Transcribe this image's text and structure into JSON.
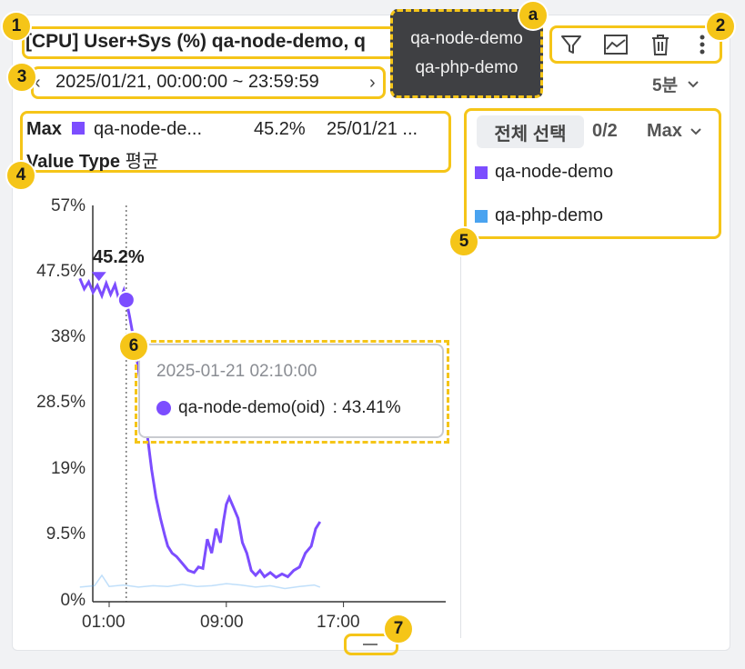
{
  "widget": {
    "title": "[CPU] User+Sys (%) qa-node-demo, q",
    "date_range": "2025/01/21, 00:00:00 ~ 23:59:59",
    "interval": "5분"
  },
  "floating_tooltip": {
    "lines": [
      "qa-node-demo",
      "qa-php-demo"
    ]
  },
  "toolbar": {
    "icons": [
      "filter-icon",
      "area-chart-icon",
      "trash-icon",
      "more-vertical-icon"
    ]
  },
  "info_panel": {
    "stat_label": "Max",
    "series": "qa-node-de...",
    "value": "45.2%",
    "time": "25/01/21 ...",
    "value_type_label": "Value Type",
    "value_type": "평균"
  },
  "legend": {
    "select_all": "전체 선택",
    "count": "0/2",
    "sort": "Max",
    "items": [
      {
        "name": "qa-node-demo",
        "color": "#7c4dff"
      },
      {
        "name": "qa-php-demo",
        "color": "#4aa3f0"
      }
    ]
  },
  "tooltip": {
    "time": "2025-01-21 02:10:00",
    "label": "qa-node-demo(oid)",
    "value": ": 43.41%"
  },
  "peak_label": "45.2%",
  "badges": {
    "b1": "1",
    "b2": "2",
    "b3": "3",
    "b4": "4",
    "b5": "5",
    "b6": "6",
    "b7": "7",
    "ba": "a"
  },
  "chart_data": {
    "type": "line",
    "y_ticks": [
      "57%",
      "47.5%",
      "38%",
      "28.5%",
      "19%",
      "9.5%",
      "0%"
    ],
    "x_ticks": [
      "01:00",
      "09:00",
      "17:00"
    ],
    "ylim": [
      0,
      57
    ],
    "xlim_hours": [
      0,
      23
    ],
    "grid": false,
    "marker": {
      "series": "qa-node-demo",
      "x": 2.17,
      "y": 43.41
    },
    "peak": {
      "x": 0.3,
      "y": 45.2
    },
    "series": [
      {
        "name": "qa-node-demo",
        "color": "#7c4dff",
        "x": [
          -1,
          -0.7,
          -0.4,
          -0.1,
          0.2,
          0.5,
          0.8,
          1.1,
          1.4,
          1.7,
          2.0,
          2.17,
          2.4,
          2.7,
          3.0,
          3.3,
          3.6,
          3.9,
          4.2,
          4.5,
          4.8,
          5.0,
          5.3,
          5.6,
          6.0,
          6.4,
          6.8,
          7.1,
          7.4,
          7.7,
          8.0,
          8.3,
          8.6,
          8.8,
          9.0,
          9.2,
          9.5,
          9.8,
          10.1,
          10.4,
          10.7,
          11.0,
          11.3,
          11.6,
          12.0,
          12.4,
          12.8,
          13.2,
          13.6,
          14.0,
          14.4,
          14.8,
          15.1,
          15.4
        ],
        "y": [
          46.5,
          45.0,
          46.0,
          44.5,
          45.5,
          44.0,
          45.8,
          44.2,
          45.6,
          43.2,
          44.8,
          43.41,
          41.0,
          37.5,
          33.5,
          28.5,
          24.0,
          19.0,
          15.0,
          12.0,
          9.5,
          8.0,
          7.0,
          6.5,
          5.5,
          4.5,
          4.2,
          5.0,
          4.8,
          9.0,
          7.0,
          10.5,
          8.5,
          11.5,
          14.0,
          15.0,
          13.5,
          12.0,
          8.5,
          7.0,
          4.5,
          3.8,
          4.5,
          3.6,
          4.2,
          3.5,
          4.0,
          3.6,
          4.5,
          5.0,
          7.0,
          8.0,
          10.5,
          11.5
        ]
      },
      {
        "name": "qa-php-demo",
        "color": "#4aa3f0",
        "x": [
          -1,
          0,
          0.5,
          1.0,
          2.0,
          3.0,
          4.0,
          5.0,
          6.0,
          7.0,
          8.0,
          9.0,
          10.0,
          11.0,
          12.0,
          13.0,
          14.0,
          15.0,
          15.4
        ],
        "y": [
          2.1,
          2.3,
          3.8,
          2.2,
          2.4,
          2.1,
          2.3,
          2.2,
          2.5,
          2.2,
          2.3,
          2.6,
          2.4,
          2.1,
          2.3,
          1.9,
          2.2,
          2.4,
          2.1
        ]
      }
    ]
  }
}
